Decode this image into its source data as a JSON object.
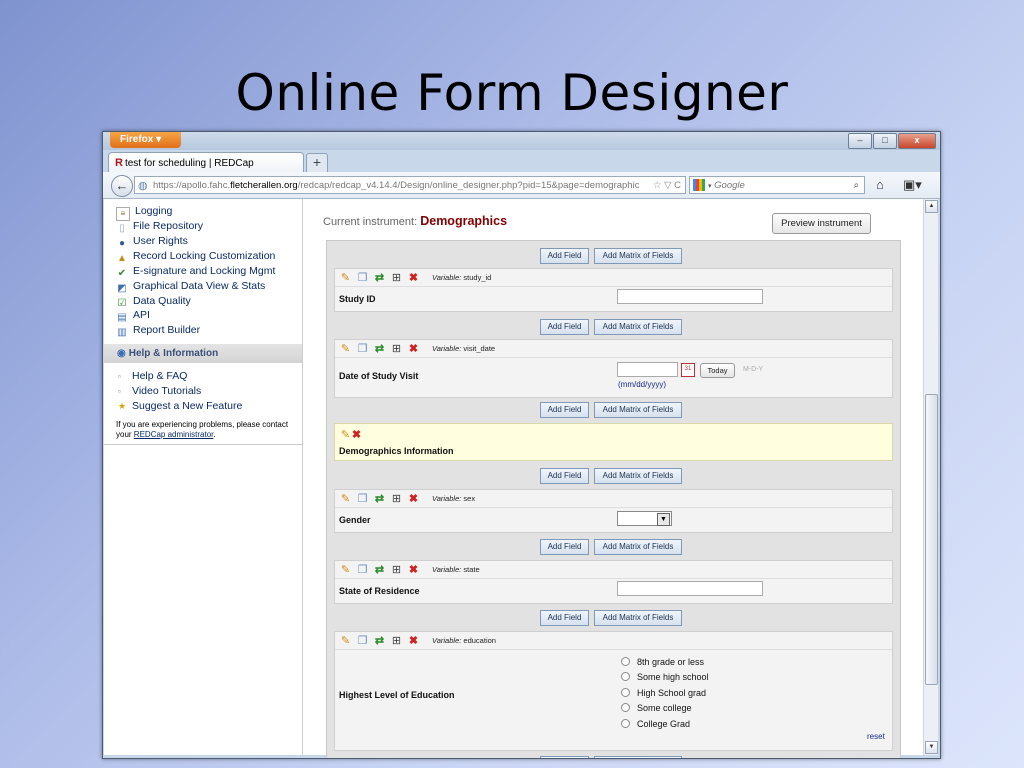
{
  "slide": {
    "title": "Online Form Designer"
  },
  "browser": {
    "app_button": "Firefox",
    "tab_title": "test for scheduling | REDCap",
    "newtab": "+",
    "url_pre": "https://apollo.fahc.",
    "url_domain": "fletcherallen.org",
    "url_post": "/redcap/redcap_v4.14.4/Design/online_designer.php?pid=15&page=demographic",
    "url_tail": "☆ ▽ C",
    "search_placeholder": "Google",
    "win_min": "–",
    "win_max": "□",
    "win_close": "x"
  },
  "sidebar": {
    "items": [
      {
        "label": "Logging",
        "icon": "logging-icon"
      },
      {
        "label": "File Repository",
        "icon": "file-repository-icon"
      },
      {
        "label": "User Rights",
        "icon": "user-rights-icon"
      },
      {
        "label": "Record Locking Customization",
        "icon": "record-locking-icon"
      },
      {
        "label": "E-signature and Locking Mgmt",
        "icon": "esignature-icon"
      },
      {
        "label": "Graphical Data View & Stats",
        "icon": "graph-icon"
      },
      {
        "label": "Data Quality",
        "icon": "data-quality-icon"
      },
      {
        "label": "API",
        "icon": "api-icon"
      },
      {
        "label": "Report Builder",
        "icon": "report-builder-icon"
      }
    ],
    "help_header": "Help & Information",
    "help_items": [
      "Help & FAQ",
      "Video Tutorials",
      "Suggest a New Feature"
    ],
    "help_note_pre": "If you are experiencing problems, please contact your ",
    "help_note_link": "REDCap administrator",
    "help_note_post": "."
  },
  "main": {
    "current_instrument_label": "Current instrument:",
    "current_instrument_name": "Demographics",
    "preview_button": "Preview instrument",
    "add_field": "Add Field",
    "add_matrix": "Add Matrix of Fields",
    "variable_prefix": "Variable:",
    "fields": {
      "study_id": {
        "variable": "study_id",
        "label": "Study ID"
      },
      "visit_date": {
        "variable": "visit_date",
        "label": "Date of Study Visit",
        "today": "Today",
        "mdy": "M-D-Y",
        "format": "(mm/dd/yyyy)"
      },
      "section": {
        "label": "Demographics Information"
      },
      "sex": {
        "variable": "sex",
        "label": "Gender"
      },
      "state": {
        "variable": "state",
        "label": "State of Residence"
      },
      "education": {
        "variable": "education",
        "label": "Highest Level of Education",
        "options": [
          "8th grade or less",
          "Some high school",
          "High School grad",
          "Some college",
          "College Grad"
        ],
        "reset": "reset"
      }
    }
  },
  "colors": {
    "instrument_name": "#800000",
    "link": "#0a2a66",
    "section_bg": "#ffffe0"
  }
}
